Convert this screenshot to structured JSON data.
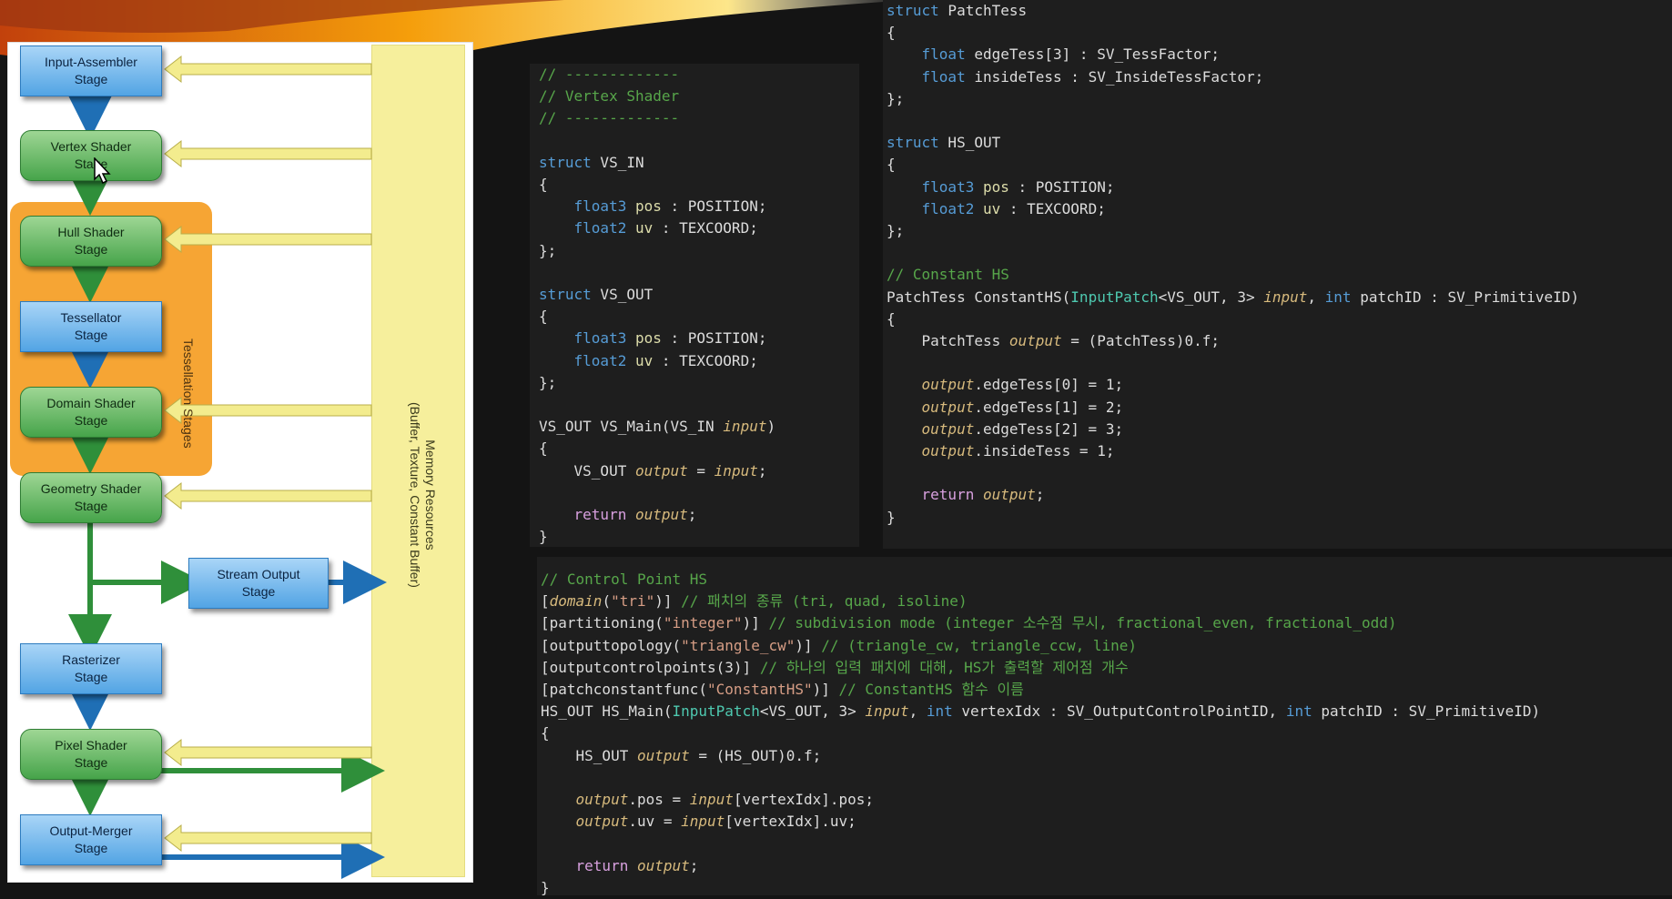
{
  "diagram": {
    "stages": [
      {
        "id": "input-assembler",
        "label": "Input-Assembler\nStage",
        "kind": "blue"
      },
      {
        "id": "vertex-shader",
        "label": "Vertex Shader\nStage",
        "kind": "green"
      },
      {
        "id": "hull-shader",
        "label": "Hull Shader\nStage",
        "kind": "green"
      },
      {
        "id": "tessellator",
        "label": "Tessellator\nStage",
        "kind": "blue"
      },
      {
        "id": "domain-shader",
        "label": "Domain Shader\nStage",
        "kind": "green"
      },
      {
        "id": "geometry-shader",
        "label": "Geometry Shader\nStage",
        "kind": "green"
      },
      {
        "id": "stream-output",
        "label": "Stream Output\nStage",
        "kind": "blue"
      },
      {
        "id": "rasterizer",
        "label": "Rasterizer\nStage",
        "kind": "blue"
      },
      {
        "id": "pixel-shader",
        "label": "Pixel Shader\nStage",
        "kind": "green"
      },
      {
        "id": "output-merger",
        "label": "Output-Merger\nStage",
        "kind": "blue"
      }
    ],
    "tessellation_label": "Tessellation Stages",
    "memory_label_1": "Memory Resources",
    "memory_label_2": "(Buffer, Texture, Constant Buffer)"
  },
  "colors": {
    "comment": "#57a64a",
    "keyword": "#569cd6",
    "identifier": "#dcdcaa",
    "italic_var": "#d7ba7d",
    "string": "#d69d85",
    "text": "#dcdcdc",
    "return": "#d8a0df",
    "type": "#4ec9b0"
  },
  "code_vs": [
    [
      [
        "c-com",
        "// -------------"
      ]
    ],
    [
      [
        "c-com",
        "// Vertex Shader"
      ]
    ],
    [
      [
        "c-com",
        "// -------------"
      ]
    ],
    [],
    [
      [
        "c-kw",
        "struct"
      ],
      [
        "c-txt",
        " VS_IN"
      ]
    ],
    [
      [
        "c-txt",
        "{"
      ]
    ],
    [
      [
        "c-txt",
        "    "
      ],
      [
        "c-kw",
        "float3"
      ],
      [
        "c-txt",
        " "
      ],
      [
        "c-id",
        "pos"
      ],
      [
        "c-txt",
        " : POSITION;"
      ]
    ],
    [
      [
        "c-txt",
        "    "
      ],
      [
        "c-kw",
        "float2"
      ],
      [
        "c-txt",
        " "
      ],
      [
        "c-id",
        "uv"
      ],
      [
        "c-txt",
        " : TEXCOORD;"
      ]
    ],
    [
      [
        "c-txt",
        "};"
      ]
    ],
    [],
    [
      [
        "c-kw",
        "struct"
      ],
      [
        "c-txt",
        " VS_OUT"
      ]
    ],
    [
      [
        "c-txt",
        "{"
      ]
    ],
    [
      [
        "c-txt",
        "    "
      ],
      [
        "c-kw",
        "float3"
      ],
      [
        "c-txt",
        " "
      ],
      [
        "c-id",
        "pos"
      ],
      [
        "c-txt",
        " : POSITION;"
      ]
    ],
    [
      [
        "c-txt",
        "    "
      ],
      [
        "c-kw",
        "float2"
      ],
      [
        "c-txt",
        " "
      ],
      [
        "c-id",
        "uv"
      ],
      [
        "c-txt",
        " : TEXCOORD;"
      ]
    ],
    [
      [
        "c-txt",
        "};"
      ]
    ],
    [],
    [
      [
        "c-txt",
        "VS_OUT VS_Main(VS_IN "
      ],
      [
        "c-it",
        "input"
      ],
      [
        "c-txt",
        ")"
      ]
    ],
    [
      [
        "c-txt",
        "{"
      ]
    ],
    [
      [
        "c-txt",
        "    VS_OUT "
      ],
      [
        "c-it",
        "output"
      ],
      [
        "c-txt",
        " = "
      ],
      [
        "c-it",
        "input"
      ],
      [
        "c-txt",
        ";"
      ]
    ],
    [],
    [
      [
        "c-txt",
        "    "
      ],
      [
        "c-ret",
        "return"
      ],
      [
        "c-txt",
        " "
      ],
      [
        "c-it",
        "output"
      ],
      [
        "c-txt",
        ";"
      ]
    ],
    [
      [
        "c-txt",
        "}"
      ]
    ]
  ],
  "code_patch": [
    [
      [
        "c-kw",
        "struct"
      ],
      [
        "c-txt",
        " PatchTess"
      ]
    ],
    [
      [
        "c-txt",
        "{"
      ]
    ],
    [
      [
        "c-txt",
        "    "
      ],
      [
        "c-kw",
        "float"
      ],
      [
        "c-txt",
        " edgeTess[3] : SV_TessFactor;"
      ]
    ],
    [
      [
        "c-txt",
        "    "
      ],
      [
        "c-kw",
        "float"
      ],
      [
        "c-txt",
        " insideTess : SV_InsideTessFactor;"
      ]
    ],
    [
      [
        "c-txt",
        "};"
      ]
    ],
    [],
    [
      [
        "c-kw",
        "struct"
      ],
      [
        "c-txt",
        " HS_OUT"
      ]
    ],
    [
      [
        "c-txt",
        "{"
      ]
    ],
    [
      [
        "c-txt",
        "    "
      ],
      [
        "c-kw",
        "float3"
      ],
      [
        "c-txt",
        " "
      ],
      [
        "c-id",
        "pos"
      ],
      [
        "c-txt",
        " : POSITION;"
      ]
    ],
    [
      [
        "c-txt",
        "    "
      ],
      [
        "c-kw",
        "float2"
      ],
      [
        "c-txt",
        " "
      ],
      [
        "c-id",
        "uv"
      ],
      [
        "c-txt",
        " : TEXCOORD;"
      ]
    ],
    [
      [
        "c-txt",
        "};"
      ]
    ],
    [],
    [
      [
        "c-com",
        "// Constant HS"
      ]
    ],
    [
      [
        "c-txt",
        "PatchTess ConstantHS("
      ],
      [
        "c-tp",
        "InputPatch"
      ],
      [
        "c-txt",
        "<VS_OUT, 3> "
      ],
      [
        "c-it",
        "input"
      ],
      [
        "c-txt",
        ", "
      ],
      [
        "c-kw",
        "int"
      ],
      [
        "c-txt",
        " patchID : SV_PrimitiveID)"
      ]
    ],
    [
      [
        "c-txt",
        "{"
      ]
    ],
    [
      [
        "c-txt",
        "    PatchTess "
      ],
      [
        "c-it",
        "output"
      ],
      [
        "c-txt",
        " = (PatchTess)0.f;"
      ]
    ],
    [],
    [
      [
        "c-txt",
        "    "
      ],
      [
        "c-it",
        "output"
      ],
      [
        "c-txt",
        ".edgeTess[0] = 1;"
      ]
    ],
    [
      [
        "c-txt",
        "    "
      ],
      [
        "c-it",
        "output"
      ],
      [
        "c-txt",
        ".edgeTess[1] = 2;"
      ]
    ],
    [
      [
        "c-txt",
        "    "
      ],
      [
        "c-it",
        "output"
      ],
      [
        "c-txt",
        ".edgeTess[2] = 3;"
      ]
    ],
    [
      [
        "c-txt",
        "    "
      ],
      [
        "c-it",
        "output"
      ],
      [
        "c-txt",
        ".insideTess = 1;"
      ]
    ],
    [],
    [
      [
        "c-txt",
        "    "
      ],
      [
        "c-ret",
        "return"
      ],
      [
        "c-txt",
        " "
      ],
      [
        "c-it",
        "output"
      ],
      [
        "c-txt",
        ";"
      ]
    ],
    [
      [
        "c-txt",
        "}"
      ]
    ]
  ],
  "code_hs": [
    [
      [
        "c-com",
        "// Control Point HS"
      ]
    ],
    [
      [
        "c-txt",
        "["
      ],
      [
        "c-it",
        "domain"
      ],
      [
        "c-txt",
        "("
      ],
      [
        "c-str",
        "\"tri\""
      ],
      [
        "c-txt",
        ")] "
      ],
      [
        "c-com",
        "// 패치의 종류 (tri, quad, isoline)"
      ]
    ],
    [
      [
        "c-txt",
        "[partitioning("
      ],
      [
        "c-str",
        "\"integer\""
      ],
      [
        "c-txt",
        ")] "
      ],
      [
        "c-com",
        "// subdivision mode (integer 소수점 무시, fractional_even, fractional_odd)"
      ]
    ],
    [
      [
        "c-txt",
        "[outputtopology("
      ],
      [
        "c-str",
        "\"triangle_cw\""
      ],
      [
        "c-txt",
        ")] "
      ],
      [
        "c-com",
        "// (triangle_cw, triangle_ccw, line)"
      ]
    ],
    [
      [
        "c-txt",
        "[outputcontrolpoints(3)] "
      ],
      [
        "c-com",
        "// 하나의 입력 패치에 대해, HS가 출력할 제어점 개수"
      ]
    ],
    [
      [
        "c-txt",
        "[patchconstantfunc("
      ],
      [
        "c-str",
        "\"ConstantHS\""
      ],
      [
        "c-txt",
        ")] "
      ],
      [
        "c-com",
        "// ConstantHS 함수 이름"
      ]
    ],
    [
      [
        "c-txt",
        "HS_OUT HS_Main("
      ],
      [
        "c-tp",
        "InputPatch"
      ],
      [
        "c-txt",
        "<VS_OUT, 3> "
      ],
      [
        "c-it",
        "input"
      ],
      [
        "c-txt",
        ", "
      ],
      [
        "c-kw",
        "int"
      ],
      [
        "c-txt",
        " vertexIdx : SV_OutputControlPointID, "
      ],
      [
        "c-kw",
        "int"
      ],
      [
        "c-txt",
        " patchID : SV_PrimitiveID)"
      ]
    ],
    [
      [
        "c-txt",
        "{"
      ]
    ],
    [
      [
        "c-txt",
        "    HS_OUT "
      ],
      [
        "c-it",
        "output"
      ],
      [
        "c-txt",
        " = (HS_OUT)0.f;"
      ]
    ],
    [],
    [
      [
        "c-txt",
        "    "
      ],
      [
        "c-it",
        "output"
      ],
      [
        "c-txt",
        ".pos = "
      ],
      [
        "c-it",
        "input"
      ],
      [
        "c-txt",
        "[vertexIdx].pos;"
      ]
    ],
    [
      [
        "c-txt",
        "    "
      ],
      [
        "c-it",
        "output"
      ],
      [
        "c-txt",
        ".uv = "
      ],
      [
        "c-it",
        "input"
      ],
      [
        "c-txt",
        "[vertexIdx].uv;"
      ]
    ],
    [],
    [
      [
        "c-txt",
        "    "
      ],
      [
        "c-ret",
        "return"
      ],
      [
        "c-txt",
        " "
      ],
      [
        "c-it",
        "output"
      ],
      [
        "c-txt",
        ";"
      ]
    ],
    [
      [
        "c-txt",
        "}"
      ]
    ]
  ]
}
